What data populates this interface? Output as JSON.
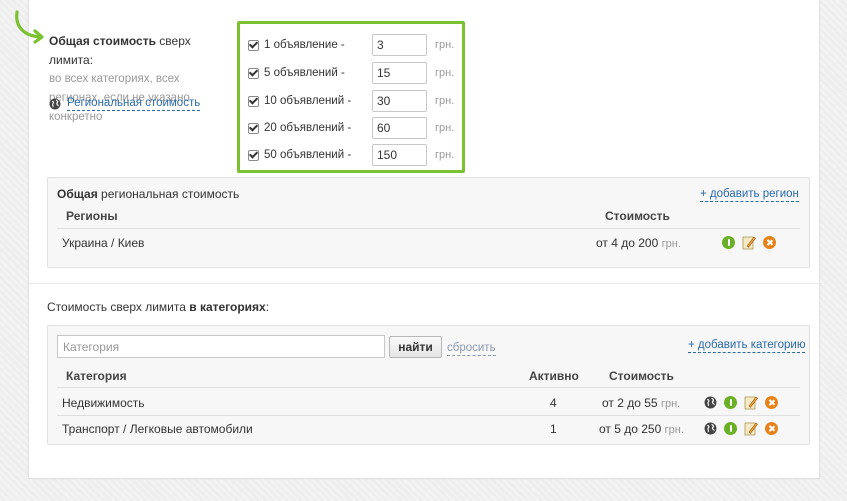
{
  "main_limit": {
    "title_bold": "Общая стоимость",
    "title_rest": " сверх лимита:",
    "description": "во всех категориях, всех регионах, если не указано конкретно",
    "regional_link": "Региональная стоимость"
  },
  "price_tiers": [
    {
      "label": "1 объявление -",
      "value": "3",
      "currency": "грн.",
      "checked": true
    },
    {
      "label": "5 объявлений -",
      "value": "15",
      "currency": "грн.",
      "checked": true
    },
    {
      "label": "10 объявлений -",
      "value": "30",
      "currency": "грн.",
      "checked": true
    },
    {
      "label": "20 объявлений -",
      "value": "60",
      "currency": "грн.",
      "checked": true
    },
    {
      "label": "50 объявлений -",
      "value": "150",
      "currency": "грн.",
      "checked": true
    }
  ],
  "regional_panel": {
    "title_bold": "Общая",
    "title_rest": " региональная стоимость",
    "add_link": "+ добавить регион",
    "col_regions": "Регионы",
    "col_cost": "Стоимость",
    "rows": [
      {
        "region": "Украина / Киев",
        "cost": "от 4 до 200",
        "currency": "грн."
      }
    ]
  },
  "category_section": {
    "title_rest": "Стоимость сверх лимита ",
    "title_bold": "в категориях",
    "title_colon": ":"
  },
  "category_panel": {
    "search_placeholder": "Категория",
    "find_button": "найти",
    "reset_link": "сбросить",
    "add_link": "+ добавить категорию",
    "col_category": "Категория",
    "col_active": "Активно",
    "col_cost": "Стоимость",
    "rows": [
      {
        "category": "Недвижимость",
        "active": "4",
        "cost": "от 2 до 55",
        "currency": "грн."
      },
      {
        "category": "Транспорт / Легковые автомобили",
        "active": "1",
        "cost": "от 5 до 250",
        "currency": "грн."
      }
    ]
  },
  "colors": {
    "accent_green": "#7ac232",
    "link_blue": "#2a6aa8",
    "info_green": "#6ab026",
    "delete_orange": "#e8821a"
  }
}
